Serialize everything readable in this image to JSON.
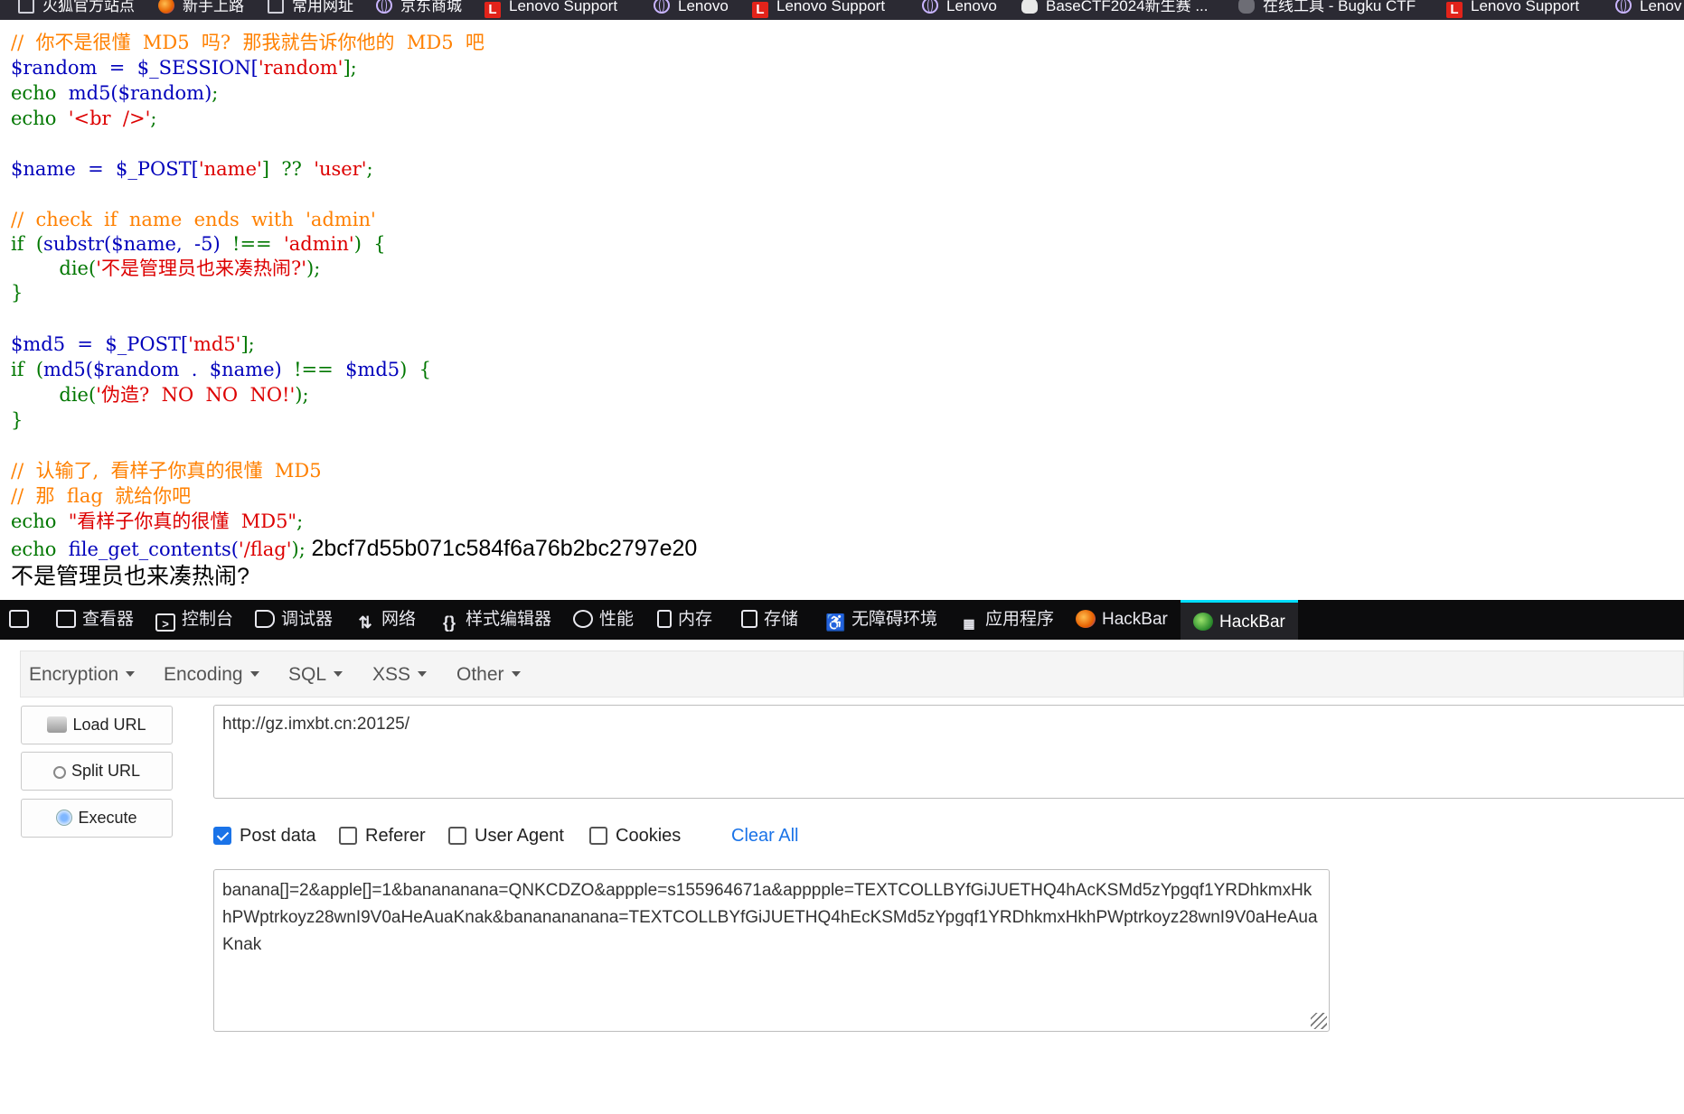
{
  "bookmarks": [
    {
      "label": "火狐官方站点",
      "icon": "folder-icon"
    },
    {
      "label": "新手上路",
      "icon": "firefox-icon"
    },
    {
      "label": "常用网址",
      "icon": "folder-icon"
    },
    {
      "label": "京东商城",
      "icon": "globe-icon"
    },
    {
      "label": "Lenovo Support",
      "icon": "lenovo-icon"
    },
    {
      "label": "Lenovo",
      "icon": "globe-icon"
    },
    {
      "label": "Lenovo Support",
      "icon": "lenovo-icon"
    },
    {
      "label": "Lenovo",
      "icon": "globe-icon"
    },
    {
      "label": "BaseCTF2024新生赛 ...",
      "icon": "ghost-icon"
    },
    {
      "label": "在线工具 - Bugku CTF",
      "icon": "bug-icon"
    },
    {
      "label": "Lenovo Support",
      "icon": "lenovo-icon"
    },
    {
      "label": "Lenov",
      "icon": "globe-icon"
    }
  ],
  "code": {
    "l0": "//  你不是很懂  MD5  吗?  那我就告诉你他的  MD5  吧",
    "l1a": "$random  =  $_SESSION[",
    "l1b": "'random'",
    "l1c": "];",
    "l2a": "echo  ",
    "l2b": "md5($random)",
    "l2c": ";",
    "l3a": "echo  ",
    "l3b": "'<br  />'",
    "l3c": ";",
    "l4a": "$name  =  $_POST[",
    "l4b": "'name'",
    "l4c": "]  ??  ",
    "l4d": "'user'",
    "l4e": ";",
    "l5": "//  check  if  name  ends  with  'admin'",
    "l6a": "if  (",
    "l6b": "substr($name,  -5)",
    "l6c": "  !==  ",
    "l6d": "'admin'",
    "l6e": ")  {",
    "l7a": "        die(",
    "l7b": "'不是管理员也来凑热闹?'",
    "l7c": ");",
    "l8": "}",
    "l9a": "$md5  =  $_POST[",
    "l9b": "'md5'",
    "l9c": "];",
    "l10a": "if  (",
    "l10b": "md5($random  .  $name)",
    "l10c": "  !==  ",
    "l10d": "$md5",
    "l10e": ")  {",
    "l11a": "        die(",
    "l11b": "'伪造?  NO  NO  NO!'",
    "l11c": ");",
    "l12": "}",
    "l13": "//  认输了,  看样子你真的很懂  MD5",
    "l14": "//  那  flag  就给你吧",
    "l15a": "echo  ",
    "l15b": "\"看样子你真的很懂  MD5\"",
    "l15c": ";",
    "l16a": "echo  ",
    "l16b": "file_get_contents(",
    "l16c": "'/flag'",
    "l16d": ");",
    "flag_output": "2bcf7d55b071c584f6a76b2bc2797e20",
    "message": "不是管理员也来凑热闹?"
  },
  "devtools": {
    "tabs": [
      "查看器",
      "控制台",
      "调试器",
      "网络",
      "样式编辑器",
      "性能",
      "内存",
      "存储",
      "无障碍环境",
      "应用程序",
      "HackBar",
      "HackBar"
    ],
    "icons": [
      "inspector-icon",
      "console-icon",
      "debugger-icon",
      "network-icon",
      "style-editor-icon",
      "performance-icon",
      "memory-icon",
      "storage-icon",
      "accessibility-icon",
      "application-icon",
      "hackbar-icon",
      "hackbar-icon"
    ],
    "active_tab": "HackBar"
  },
  "hackbar": {
    "menu": [
      "Encryption",
      "Encoding",
      "SQL",
      "XSS",
      "Other"
    ],
    "buttons": {
      "load": "Load URL",
      "split": "Split URL",
      "execute": "Execute"
    },
    "url": "http://gz.imxbt.cn:20125/",
    "options": {
      "post_data": "Post data",
      "referer": "Referer",
      "user_agent": "User Agent",
      "cookies": "Cookies"
    },
    "checked": {
      "post_data": true,
      "referer": false,
      "user_agent": false,
      "cookies": false
    },
    "clear_all": "Clear All",
    "post_body": "banana[]=2&apple[]=1&banananana=QNKCDZO&appple=s155964671a&apppple=TEXTCOLLBYfGiJUETHQ4hAcKSMd5zYpgqf1YRDhkmxHkhPWptrkoyz28wnI9V0aHeAuaKnak&bananananana=TEXTCOLLBYfGiJUETHQ4hEcKSMd5zYpgqf1YRDhkmxHkhPWptrkoyz28wnI9V0aHeAuaKnak"
  },
  "colors": {
    "keyword": "#007700",
    "variable": "#0000bb",
    "string": "#dd0000",
    "comment": "#ff8000",
    "accent": "#1a73e8"
  }
}
